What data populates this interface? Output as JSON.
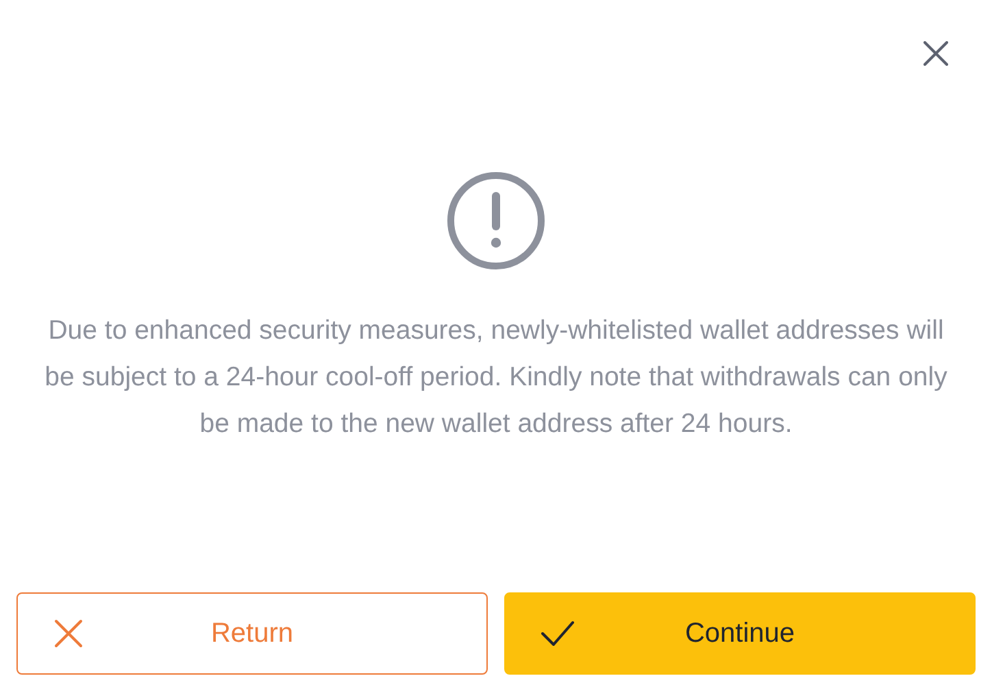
{
  "dialog": {
    "message": "Due to enhanced security measures, newly-whitelisted wallet addresses will be subject to a 24-hour cool-off period. Kindly note that withdrawals can only be made to the new wallet address after 24 hours.",
    "buttons": [
      {
        "kind": "secondary",
        "label": "Return"
      },
      {
        "kind": "primary",
        "label": "Continue"
      }
    ]
  }
}
